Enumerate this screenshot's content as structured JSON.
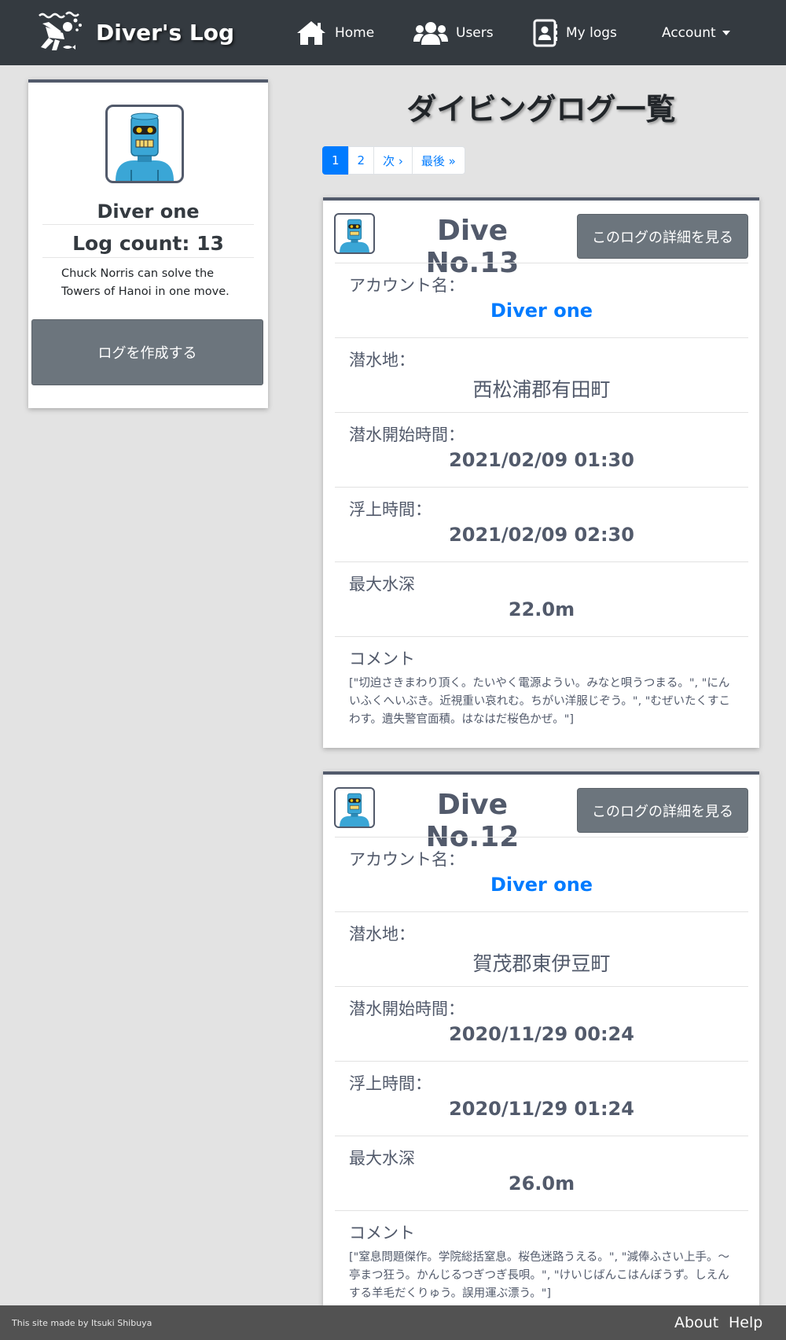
{
  "navbar": {
    "brand": "Diver's Log",
    "home": "Home",
    "users": "Users",
    "mylogs": "My logs",
    "account": "Account"
  },
  "profile": {
    "name": "Diver one",
    "log_count": "Log count: 13",
    "bio": "Chuck Norris can solve the Towers of Hanoi in one move.",
    "create_button": "ログを作成する"
  },
  "main": {
    "title": "ダイビングログ一覧",
    "pagination": [
      "1",
      "2",
      "次 ›",
      "最後 »"
    ],
    "logs": [
      {
        "title": "Dive No.13",
        "detail_button": "このログの詳細を見る",
        "account_label": "アカウント名：",
        "account": "Diver one",
        "place_label": "潜水地：",
        "place": "西松浦郡有田町",
        "start_label": "潜水開始時間：",
        "start": "2021/02/09 01:30",
        "end_label": "浮上時間：",
        "end": "2021/02/09 02:30",
        "depth_label": "最大水深",
        "depth": "22.0m",
        "comment_label": "コメント",
        "comment": "[\"切迫さきまわり頂く。たいやく電源ようい。みなと唄うつまる。\", \"にんいふくへいぶき。近視重い哀れむ。ちがい洋服じぞう。\", \"むぜいたくすこわす。遺失警官面積。はなはだ桜色かぜ。\"]"
      },
      {
        "title": "Dive No.12",
        "detail_button": "このログの詳細を見る",
        "account_label": "アカウント名：",
        "account": "Diver one",
        "place_label": "潜水地：",
        "place": "賀茂郡東伊豆町",
        "start_label": "潜水開始時間：",
        "start": "2020/11/29 00:24",
        "end_label": "浮上時間：",
        "end": "2020/11/29 01:24",
        "depth_label": "最大水深",
        "depth": "26.0m",
        "comment_label": "コメント",
        "comment": "[\"窒息問題傑作。学院総括窒息。桜色迷路うえる。\", \"減俸ふさい上手。〜亭まつ狂う。かんじるつぎつぎ長唄。\", \"けいじばんこはんぼうず。しえんする羊毛だくりゅう。誤用運ぶ漂う。\"]"
      }
    ]
  },
  "footer": {
    "credit": "This site made by Itsuki Shibuya",
    "about": "About",
    "help": "Help"
  },
  "colors": {
    "navbar": "#343a40",
    "accent_link": "#007bff",
    "button_gray": "#6c757d",
    "card_border": "#525a6b",
    "footer": "#525252"
  },
  "icons": [
    "scuba-diver-logo",
    "home-icon",
    "users-icon",
    "contact-book-icon",
    "robot-avatar"
  ]
}
